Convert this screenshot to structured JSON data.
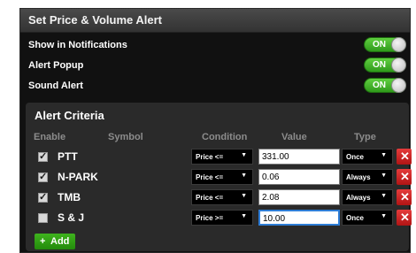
{
  "header": {
    "title": "Set Price & Volume Alert"
  },
  "settings": [
    {
      "label": "Show in Notifications",
      "toggle": "ON"
    },
    {
      "label": "Alert Popup",
      "toggle": "ON"
    },
    {
      "label": "Sound Alert",
      "toggle": "ON"
    }
  ],
  "criteria": {
    "title": "Alert Criteria",
    "columns": {
      "enable": "Enable",
      "symbol": "Symbol",
      "condition": "Condition",
      "value": "Value",
      "type": "Type"
    },
    "rows": [
      {
        "checked": "✓",
        "symbol": "PTT",
        "condition": "Price <=",
        "value": "331.00",
        "type": "Once"
      },
      {
        "checked": "✓",
        "symbol": "N-PARK",
        "condition": "Price <=",
        "value": "0.06",
        "type": "Always"
      },
      {
        "checked": "✓",
        "symbol": "TMB",
        "condition": "Price <=",
        "value": "2.08",
        "type": "Always"
      },
      {
        "checked": "",
        "symbol": "S & J",
        "condition": "Price >=",
        "value": "10.00",
        "type": "Once"
      }
    ],
    "delete_glyph": "✕",
    "dropdown_glyph": "▼",
    "add_icon": "+",
    "add_label": "Add"
  }
}
